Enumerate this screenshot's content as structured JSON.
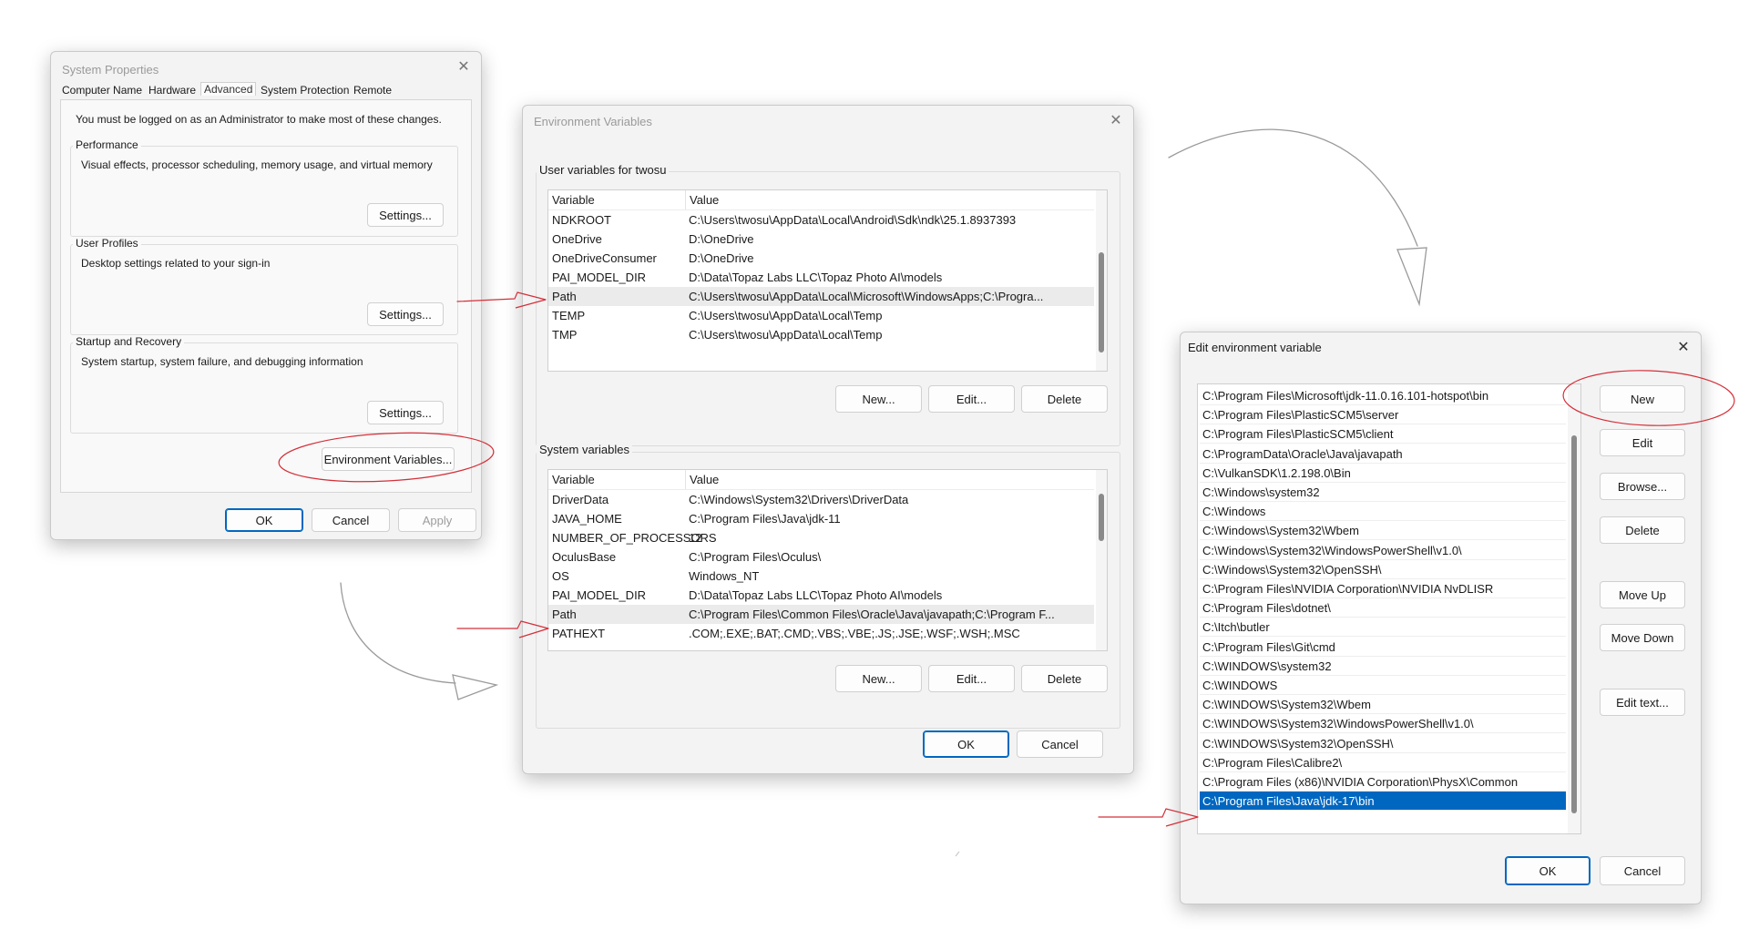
{
  "system_properties": {
    "title": "System Properties",
    "tabs": [
      "Computer Name",
      "Hardware",
      "Advanced",
      "System Protection",
      "Remote"
    ],
    "admin_note": "You must be logged on as an Administrator to make most of these changes.",
    "performance": {
      "label": "Performance",
      "desc": "Visual effects, processor scheduling, memory usage, and virtual memory",
      "button": "Settings..."
    },
    "user_profiles": {
      "label": "User Profiles",
      "desc": "Desktop settings related to your sign-in",
      "button": "Settings..."
    },
    "startup": {
      "label": "Startup and Recovery",
      "desc": "System startup, system failure, and debugging information",
      "button": "Settings..."
    },
    "env_button": "Environment Variables...",
    "ok": "OK",
    "cancel": "Cancel",
    "apply": "Apply"
  },
  "environment_variables": {
    "title": "Environment Variables",
    "user_section": "User variables for twosu",
    "system_section": "System variables",
    "col_variable": "Variable",
    "col_value": "Value",
    "user_vars": [
      {
        "name": "NDKROOT",
        "value": "C:\\Users\\twosu\\AppData\\Local\\Android\\Sdk\\ndk\\25.1.8937393"
      },
      {
        "name": "OneDrive",
        "value": "D:\\OneDrive"
      },
      {
        "name": "OneDriveConsumer",
        "value": "D:\\OneDrive"
      },
      {
        "name": "PAI_MODEL_DIR",
        "value": "D:\\Data\\Topaz Labs LLC\\Topaz Photo AI\\models"
      },
      {
        "name": "Path",
        "value": "C:\\Users\\twosu\\AppData\\Local\\Microsoft\\WindowsApps;C:\\Progra..."
      },
      {
        "name": "TEMP",
        "value": "C:\\Users\\twosu\\AppData\\Local\\Temp"
      },
      {
        "name": "TMP",
        "value": "C:\\Users\\twosu\\AppData\\Local\\Temp"
      }
    ],
    "system_vars": [
      {
        "name": "DriverData",
        "value": "C:\\Windows\\System32\\Drivers\\DriverData"
      },
      {
        "name": "JAVA_HOME",
        "value": "C:\\Program Files\\Java\\jdk-11"
      },
      {
        "name": "NUMBER_OF_PROCESSORS",
        "value": "12"
      },
      {
        "name": "OculusBase",
        "value": "C:\\Program Files\\Oculus\\"
      },
      {
        "name": "OS",
        "value": "Windows_NT"
      },
      {
        "name": "PAI_MODEL_DIR",
        "value": "D:\\Data\\Topaz Labs LLC\\Topaz Photo AI\\models"
      },
      {
        "name": "Path",
        "value": "C:\\Program Files\\Common Files\\Oracle\\Java\\javapath;C:\\Program F..."
      },
      {
        "name": "PATHEXT",
        "value": ".COM;.EXE;.BAT;.CMD;.VBS;.VBE;.JS;.JSE;.WSF;.WSH;.MSC"
      }
    ],
    "new": "New...",
    "edit": "Edit...",
    "delete": "Delete",
    "ok": "OK",
    "cancel": "Cancel"
  },
  "edit_env": {
    "title": "Edit environment variable",
    "entries": [
      "C:\\Program Files\\Microsoft\\jdk-11.0.16.101-hotspot\\bin",
      "C:\\Program Files\\PlasticSCM5\\server",
      "C:\\Program Files\\PlasticSCM5\\client",
      "C:\\ProgramData\\Oracle\\Java\\javapath",
      "C:\\VulkanSDK\\1.2.198.0\\Bin",
      "C:\\Windows\\system32",
      "C:\\Windows",
      "C:\\Windows\\System32\\Wbem",
      "C:\\Windows\\System32\\WindowsPowerShell\\v1.0\\",
      "C:\\Windows\\System32\\OpenSSH\\",
      "C:\\Program Files\\NVIDIA Corporation\\NVIDIA NvDLISR",
      "C:\\Program Files\\dotnet\\",
      "C:\\Itch\\butler",
      "C:\\Program Files\\Git\\cmd",
      "C:\\WINDOWS\\system32",
      "C:\\WINDOWS",
      "C:\\WINDOWS\\System32\\Wbem",
      "C:\\WINDOWS\\System32\\WindowsPowerShell\\v1.0\\",
      "C:\\WINDOWS\\System32\\OpenSSH\\",
      "C:\\Program Files\\Calibre2\\",
      "C:\\Program Files (x86)\\NVIDIA Corporation\\PhysX\\Common",
      "C:\\Program Files\\Java\\jdk-17\\bin"
    ],
    "buttons": {
      "new": "New",
      "edit": "Edit",
      "browse": "Browse...",
      "delete": "Delete",
      "move_up": "Move Up",
      "move_down": "Move Down",
      "edit_text": "Edit text...",
      "ok": "OK",
      "cancel": "Cancel"
    }
  },
  "colors": {
    "selection": "#0067c0",
    "annotation": "#d4303a",
    "annotation_arrow": "#9a9a9a"
  }
}
